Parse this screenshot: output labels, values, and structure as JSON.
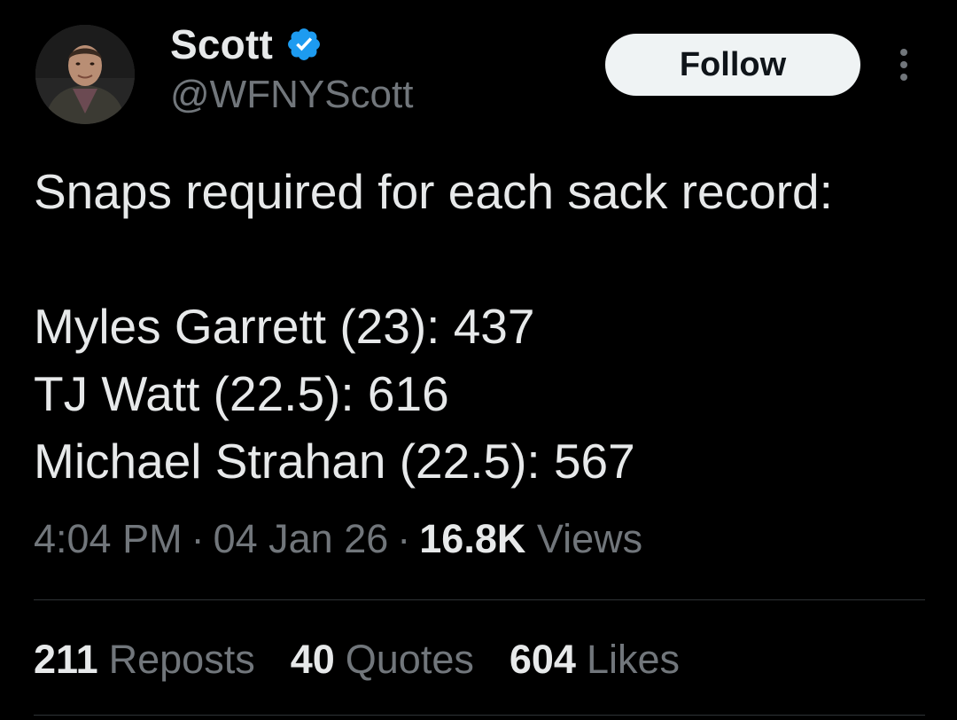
{
  "author": {
    "display_name": "Scott",
    "handle": "@WFNYScott",
    "verified_icon": "verified-badge-icon",
    "verified_color": "#1d9bf0"
  },
  "follow_button": {
    "label": "Follow"
  },
  "more_icon": "more-dots-icon",
  "tweet": {
    "lines": [
      "Snaps required for each sack record:",
      "",
      "Myles Garrett (23): 437",
      "TJ Watt (22.5): 616",
      "Michael Strahan (22.5): 567"
    ]
  },
  "meta": {
    "time": "4:04 PM",
    "date": "04 Jan 26",
    "separator": "·",
    "views_count": "16.8K",
    "views_label": "Views"
  },
  "stats": {
    "reposts": {
      "count": "211",
      "label": "Reposts"
    },
    "quotes": {
      "count": "40",
      "label": "Quotes"
    },
    "likes": {
      "count": "604",
      "label": "Likes"
    }
  },
  "colors": {
    "background": "#000000",
    "primary_text": "#e7e9ea",
    "secondary_text": "#71767b",
    "divider": "#2f3336",
    "follow_bg": "#eff3f4"
  }
}
